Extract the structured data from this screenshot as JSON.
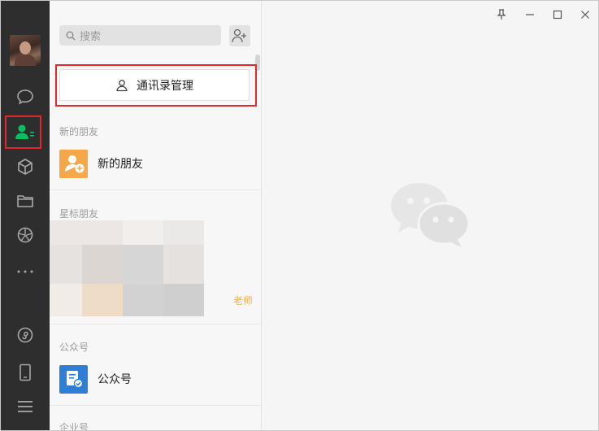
{
  "search": {
    "placeholder": "搜索"
  },
  "contacts_manage": {
    "label": "通讯录管理"
  },
  "sections": {
    "new_friends": {
      "header": "新的朋友",
      "item": "新的朋友"
    },
    "starred": {
      "header": "星标朋友",
      "visible_fragment": "老师"
    },
    "official": {
      "header": "公众号",
      "item": "公众号"
    },
    "enterprise": {
      "header": "企业号"
    }
  },
  "rail": {
    "items": [
      "chat-icon",
      "contacts-icon",
      "favorites-icon",
      "files-icon",
      "moments-icon",
      "more-icon",
      "mini-program-icon",
      "phone-icon",
      "menu-icon"
    ],
    "active": "contacts-icon"
  },
  "colors": {
    "rail_bg": "#2e2e2e",
    "active_green": "#07c160",
    "highlight_red": "#e02a2a",
    "new_friend_orange": "#f6a74a",
    "official_blue": "#2e7ed6"
  }
}
